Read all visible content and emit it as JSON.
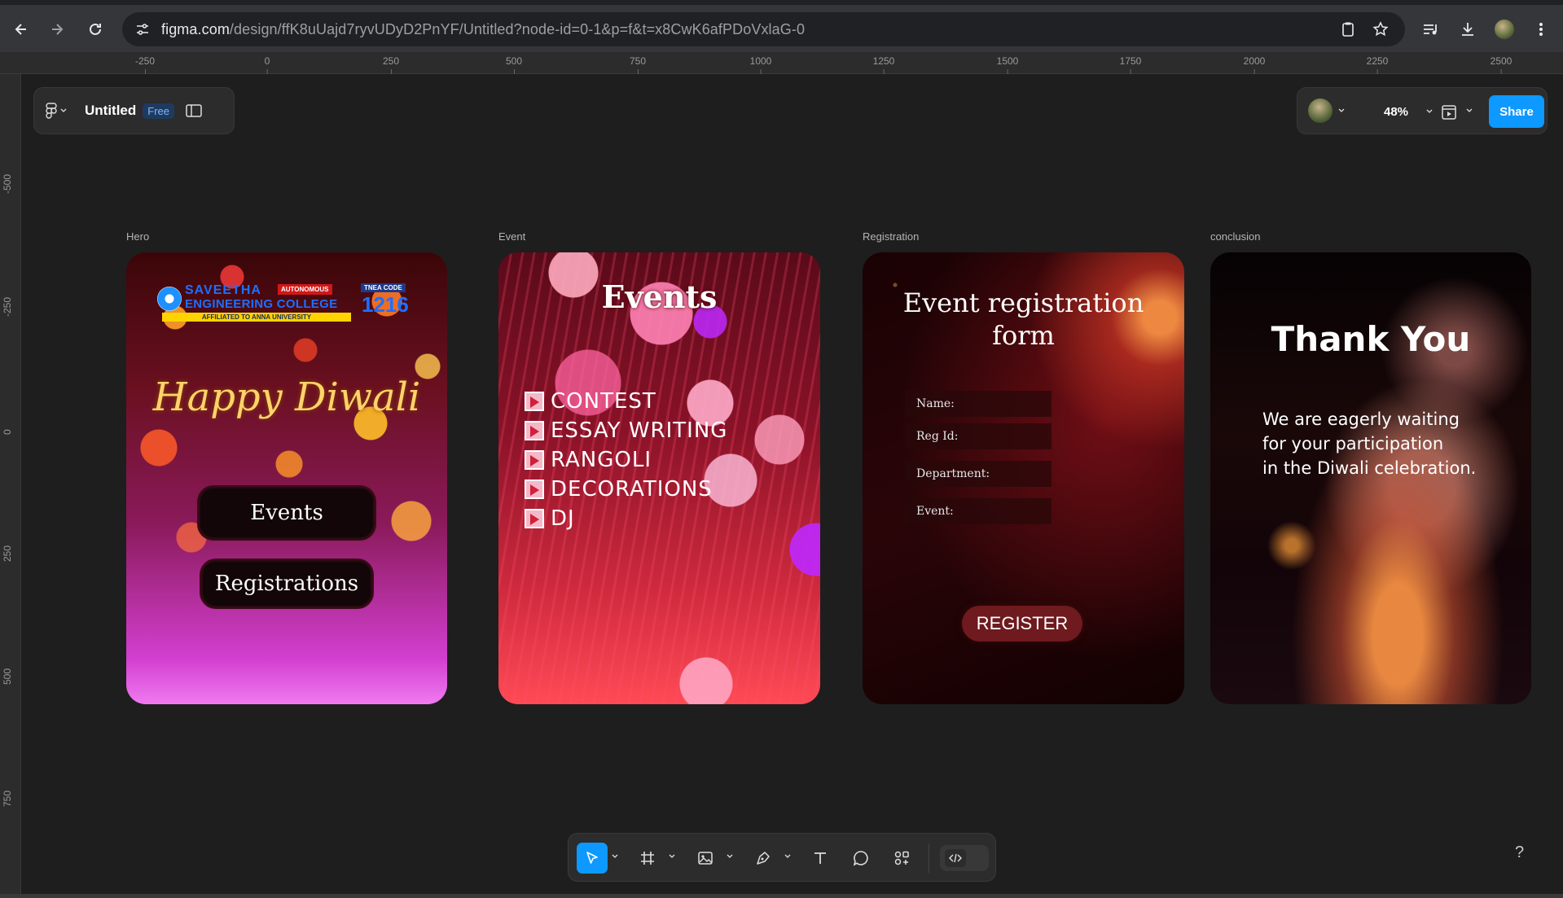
{
  "browser": {
    "url_domain": "figma.com",
    "url_rest": "/design/ffK8uUajd7ryvUDyD2PnYF/Untitled?node-id=0-1&p=f&t=x8CwK6afPDoVxlaG-0"
  },
  "rulers": {
    "horizontal": [
      "-250",
      "0",
      "250",
      "500",
      "750",
      "1000",
      "1250",
      "1500",
      "1750",
      "2000",
      "2250",
      "2500"
    ],
    "vertical": [
      "-500",
      "-250",
      "0",
      "250",
      "500",
      "750"
    ]
  },
  "file": {
    "name": "Untitled",
    "plan": "Free"
  },
  "top_right": {
    "zoom": "48%",
    "share_label": "Share"
  },
  "frames": {
    "hero": {
      "label": "Hero",
      "college_line1": "SAVEETHA",
      "college_badge": "AUTONOMOUS",
      "college_line2": "ENGINEERING COLLEGE",
      "college_affil": "AFFILIATED TO ANNA UNIVERSITY",
      "tnea_label": "TNEA CODE",
      "tnea_code": "1216",
      "greeting": "Happy Diwali",
      "btn_events": "Events",
      "btn_registrations": "Registrations"
    },
    "event": {
      "label": "Event",
      "title": "Events",
      "items": [
        "CONTEST",
        "ESSAY WRITING",
        "RANGOLI",
        "DECORATIONS",
        "DJ"
      ]
    },
    "registration": {
      "label": "Registration",
      "title_line1": "Event registration",
      "title_line2": "form",
      "fields": [
        "Name:",
        "Reg Id:",
        "Department:",
        "Event:"
      ],
      "button": "REGISTER"
    },
    "conclusion": {
      "label": "conclusion",
      "title": "Thank You",
      "message_line1": "We are eagerly waiting",
      "message_line2": "for your participation",
      "message_line3": "in the Diwali celebration."
    }
  },
  "help": "?",
  "colors": {
    "accent": "#0d99ff",
    "canvas": "#1e1e1e",
    "panel": "#2c2c2c"
  }
}
